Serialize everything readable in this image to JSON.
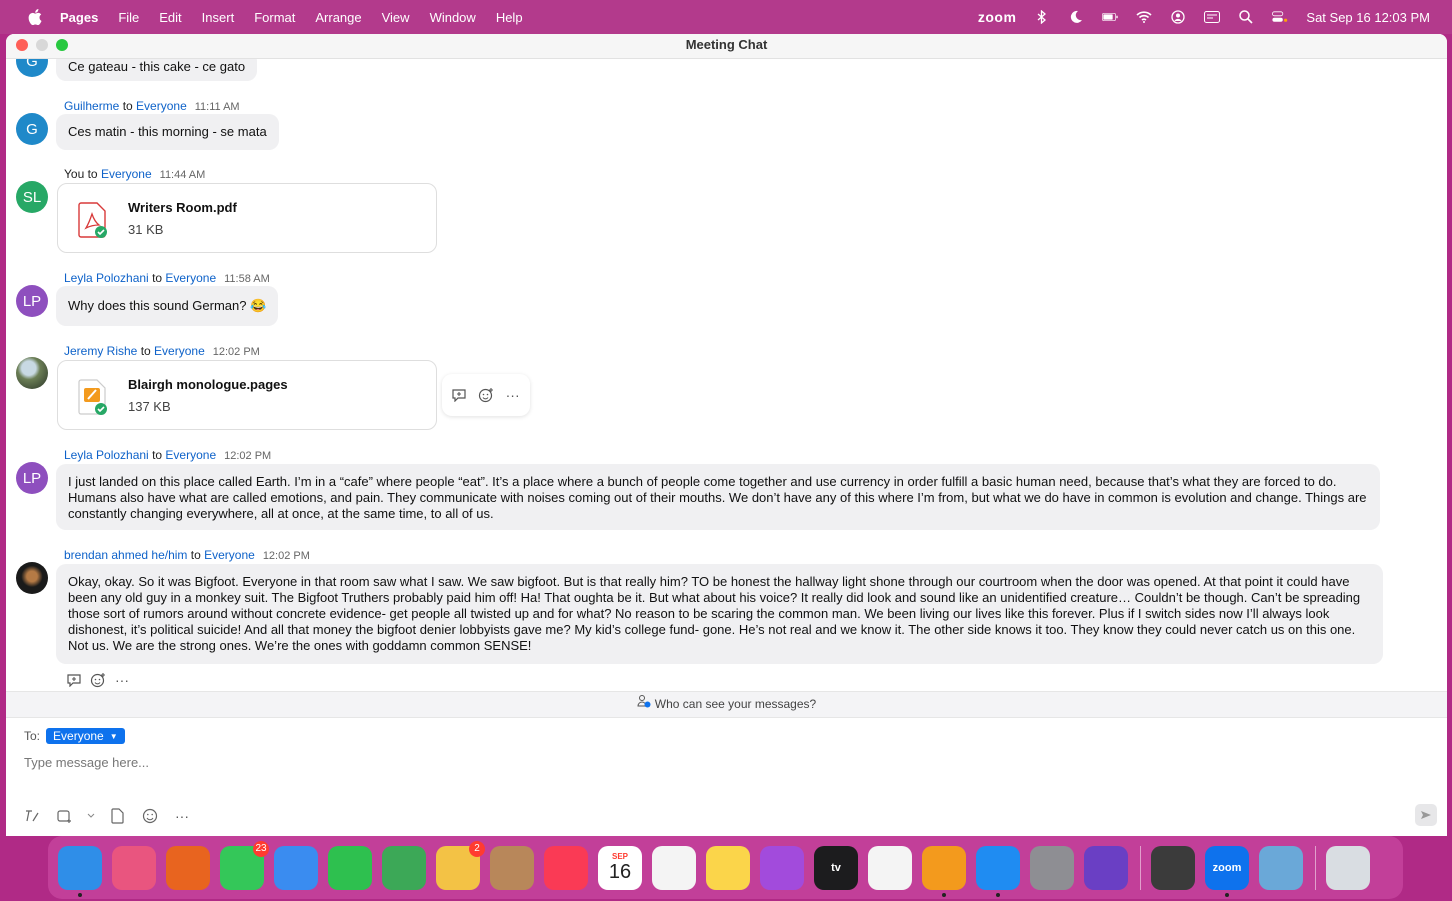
{
  "menubar": {
    "app": "Pages",
    "items": [
      "File",
      "Edit",
      "Insert",
      "Format",
      "Arrange",
      "View",
      "Window",
      "Help"
    ],
    "status_app": "zoom",
    "clock": "Sat Sep 16  12:03 PM"
  },
  "window": {
    "title": "Meeting Chat"
  },
  "messages": [
    {
      "sender": "",
      "to_word": "",
      "to": "",
      "time": "",
      "avatar": "G",
      "text": "Ce gateau - this cake - ce gato"
    },
    {
      "sender": "Guilherme",
      "to_word": " to ",
      "to": "Everyone",
      "time": "11:11 AM",
      "avatar": "G",
      "text": "Ces matin - this morning - se mata"
    },
    {
      "sender": "You",
      "to_word": " to ",
      "to": "Everyone",
      "time": "11:44 AM",
      "avatar": "SL",
      "file": {
        "name": "Writers Room.pdf",
        "size": "31 KB"
      }
    },
    {
      "sender": "Leyla Polozhani",
      "to_word": " to ",
      "to": "Everyone",
      "time": "11:58 AM",
      "avatar": "LP",
      "text": "Why does this sound German? 😂"
    },
    {
      "sender": "Jeremy Rishe",
      "to_word": " to ",
      "to": "Everyone",
      "time": "12:02 PM",
      "avatar": "",
      "file": {
        "name": "Blairgh monologue.pages",
        "size": "137 KB"
      }
    },
    {
      "sender": "Leyla Polozhani",
      "to_word": " to ",
      "to": "Everyone",
      "time": "12:02 PM",
      "avatar": "LP",
      "text": "I just landed on this place called Earth. I’m in a “cafe” where people “eat”. It’s a place where a bunch of people come together and use currency in order fulfill a basic human need, because that’s what they are forced to do. Humans also have what are called emotions, and pain. They communicate with noises coming out of their mouths. We don’t have any of this where I’m from, but what we do have in common is evolution and change. Things are constantly changing everywhere, all at once, at the same time, to all of us."
    },
    {
      "sender": "brendan ahmed he/him",
      "to_word": " to ",
      "to": "Everyone",
      "time": "12:02 PM",
      "avatar": "",
      "text": "Okay, okay. So it was Bigfoot. Everyone in that room saw what I saw. We saw bigfoot. But is that really him? TO be honest the hallway light shone through our courtroom when the door was opened. At that point it could have been any old guy in a monkey suit. The Bigfoot Truthers probably paid him off! Ha! That oughta be it. But what about his voice? It really did look and sound like an unidentified creature… Couldn’t be though. Can’t be spreading those sort of rumors around without concrete evidence- get people all twisted up and for what? No reason to be scaring the common man. We been living our lives like this forever. Plus if I switch sides now I’ll always look dishonest, it’s political suicide! And all that money the bigfoot denier lobbyists gave me? My kid’s college fund- gone. He’s not real and we know it. The other side knows it too. They know they could never catch us on this one. Not us. We are the strong ones. We’re the ones with goddamn common SENSE!"
    }
  ],
  "more_glyph": "···",
  "privacy_text": "Who can see your messages?",
  "compose": {
    "to_label": "To:",
    "recipient": "Everyone",
    "placeholder": "Type message here..."
  },
  "dock": {
    "apps": [
      {
        "icon": "finder-icon",
        "color": "#2f8ee8"
      },
      {
        "icon": "launchpad-icon",
        "color": "#e9557f"
      },
      {
        "icon": "firefox-icon",
        "color": "#e8641f"
      },
      {
        "icon": "messages-icon",
        "color": "#34c759",
        "badge": "23"
      },
      {
        "icon": "mail-icon",
        "color": "#3a8cf0"
      },
      {
        "icon": "facetime-icon",
        "color": "#2ec04f"
      },
      {
        "icon": "maps-icon",
        "color": "#3ca857"
      },
      {
        "icon": "photos-icon",
        "color": "#f3c245",
        "badge": "2"
      },
      {
        "icon": "contacts-icon",
        "color": "#b8875a"
      },
      {
        "icon": "music-icon",
        "color": "#fa3a55"
      },
      {
        "icon": "calendar-icon",
        "color": "#ffffff",
        "month": "SEP",
        "day": "16"
      },
      {
        "icon": "reminders-icon",
        "color": "#f4f4f4"
      },
      {
        "icon": "notes-icon",
        "color": "#fbd54a"
      },
      {
        "icon": "podcasts-icon",
        "color": "#a24bdc"
      },
      {
        "icon": "tv-icon",
        "color": "#1c1c1e",
        "label": "tv"
      },
      {
        "icon": "news-icon",
        "color": "#f4f4f4"
      },
      {
        "icon": "pages-icon",
        "color": "#f39a1d"
      },
      {
        "icon": "app-store-icon",
        "color": "#1f8cf2"
      },
      {
        "icon": "system-preferences-icon",
        "color": "#8e8e93"
      },
      {
        "icon": "imovie-icon",
        "color": "#6a3fc4"
      },
      {
        "icon": "quicktime-icon",
        "color": "#3b3b3b"
      },
      {
        "icon": "zoom-icon",
        "color": "#0e72ed",
        "label": "zoom"
      },
      {
        "icon": "preview-icon",
        "color": "#6aa8d8"
      },
      {
        "icon": "trash-icon",
        "color": "#d9dde2"
      }
    ]
  }
}
